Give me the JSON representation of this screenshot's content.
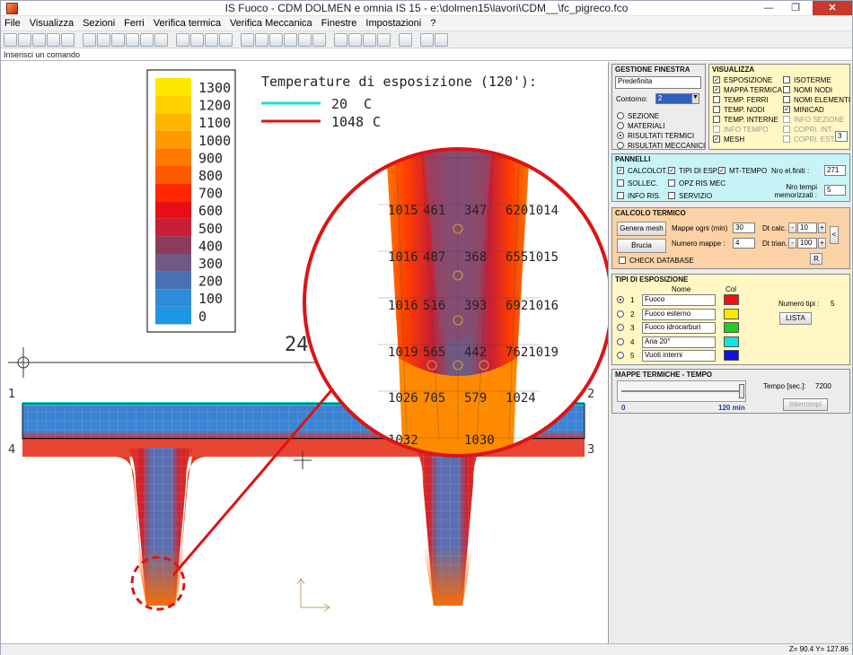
{
  "window": {
    "title": "IS Fuoco - CDM DOLMEN e omnia IS 15 - e:\\dolmen15\\lavori\\CDM__\\fc_pigreco.fco",
    "min_glyph": "—",
    "max_glyph": "❐",
    "close_glyph": "✕"
  },
  "menu": [
    "File",
    "Visualizza",
    "Sezioni",
    "Ferri",
    "Verifica termica",
    "Verifica Meccanica",
    "Finestre",
    "Impostazioni",
    "?"
  ],
  "command_line": "Inserisci un comando",
  "drawing": {
    "legend_values": [
      "1300",
      "1200",
      "1100",
      "1000",
      "900",
      "800",
      "700",
      "600",
      "500",
      "400",
      "300",
      "200",
      "100",
      "0"
    ],
    "legend_colors": [
      "#ffe800",
      "#ffd200",
      "#ffb400",
      "#ff9a00",
      "#ff7a00",
      "#ff5a00",
      "#ff2800",
      "#e60f14",
      "#c81e37",
      "#8c3c5a",
      "#6e5a82",
      "#4a70b4",
      "#2f8bd8",
      "#1e96e6"
    ],
    "exposure_title": "Temperature di esposizione (120'):",
    "exposure_items": [
      {
        "value": "20",
        "unit": "C",
        "color": "#19dcdc"
      },
      {
        "value": "1048",
        "unit": "C",
        "color": "#dc1414"
      }
    ],
    "dimension_label": "249",
    "node_labels": [
      "1",
      "2",
      "3",
      "4"
    ],
    "zoom_grid": [
      [
        "1015",
        "461",
        "347",
        "6201014"
      ],
      [
        "1016",
        "487",
        "368",
        "6551015"
      ],
      [
        "1016",
        "516",
        "393",
        "6921016"
      ],
      [
        "1019",
        "565",
        "442",
        "7621019"
      ],
      [
        "1026",
        "705",
        "579",
        "1024"
      ],
      [
        "1032",
        "",
        "1030",
        ""
      ]
    ]
  },
  "panel": {
    "gestione": {
      "title": "GESTIONE FINESTRA",
      "preset": "Predefinita",
      "contorno_label": "Contorno:",
      "contorno_value": "2",
      "options": [
        "SEZIONE",
        "MATERIALI",
        "RISULTATI TERMICI",
        "RISULTATI MECCANICI"
      ],
      "selected": 2
    },
    "visualizza": {
      "title": "VISUALIZZA",
      "left": [
        {
          "label": "ESPOSIZIONE",
          "checked": true
        },
        {
          "label": "MAPPA TERMICA",
          "checked": true
        },
        {
          "label": "TEMP. FERRI",
          "checked": false
        },
        {
          "label": "TEMP. NODI",
          "checked": false
        },
        {
          "label": "TEMP. INTERNE",
          "checked": false
        },
        {
          "label": "INFO TEMPO",
          "checked": false,
          "disabled": true
        },
        {
          "label": "MESH",
          "checked": true
        }
      ],
      "right": [
        {
          "label": "ISOTERME",
          "checked": false
        },
        {
          "label": "NOMI NODI",
          "checked": false
        },
        {
          "label": "NOMI ELEMENTI",
          "checked": false
        },
        {
          "label": "MINICAD",
          "checked": true
        },
        {
          "label": "INFO SEZIONE",
          "checked": false,
          "disabled": true
        },
        {
          "label": "COPRI. INT.",
          "checked": false,
          "disabled": true
        },
        {
          "label": "COPRI. EST.",
          "checked": false,
          "disabled": true
        }
      ],
      "copri_value": "3"
    },
    "pannelli": {
      "title": "PANNELLI",
      "items": [
        {
          "label": "CALCOLOT.",
          "checked": true
        },
        {
          "label": "TIPI DI ESP.",
          "checked": true
        },
        {
          "label": "MT-TEMPO",
          "checked": true
        },
        {
          "label": "SOLLEC.",
          "checked": false
        },
        {
          "label": "OPZ RIS MEC",
          "checked": false
        },
        {
          "label": "INFO RIS.",
          "checked": false
        },
        {
          "label": "SERVIZIO",
          "checked": false
        }
      ],
      "nro_finiti_label": "Nro el.finiti :",
      "nro_finiti_value": "271",
      "nro_tempi_label": "Nro tempi memorizzati :",
      "nro_tempi_value": "5"
    },
    "calcolo": {
      "title": "CALCOLO TERMICO",
      "genera_mesh": "Genera mesh",
      "brucia": "Brucia",
      "mappe_label": "Mappe ogni (min)",
      "mappe_value": "30",
      "numero_label": "Numero mappe :",
      "numero_value": "4",
      "dtcalc_label": "Dt calc.",
      "dtcalc_value": "10",
      "dttrian_label": "Dt trian.",
      "dttrian_value": "100",
      "check_database": "CHECK DATABASE",
      "r_button": "R",
      "minus": "-",
      "plus": "+",
      "collapse": "<"
    },
    "tipi": {
      "title": "TIPI DI ESPOSIZIONE",
      "col_nome": "Nome",
      "col_col": "Col",
      "rows": [
        {
          "n": "1",
          "name": "Fuoco",
          "color": "#ee1111",
          "selected": true
        },
        {
          "n": "2",
          "name": "Fuoco esterno",
          "color": "#ffe800",
          "selected": false
        },
        {
          "n": "3",
          "name": "Fuoco idrocarburi",
          "color": "#22cc22",
          "selected": false
        },
        {
          "n": "4",
          "name": "Aria 20°",
          "color": "#19e0e0",
          "selected": false
        },
        {
          "n": "5",
          "name": "Vuoti interni",
          "color": "#1010e0",
          "selected": false
        }
      ],
      "numero_tipi_label": "Numero tipi :",
      "numero_tipi_value": "5",
      "lista": "LISTA"
    },
    "mappe": {
      "title": "MAPPE TERMICHE - TEMPO",
      "tempo_label": "Tempo [sec.]:",
      "tempo_value": "7200",
      "start": "0",
      "end": "120 min",
      "slider_position": 1.0,
      "interrompi": "Interrompi"
    }
  },
  "status": {
    "coords": "Z= 90.4 Y= 127.86"
  }
}
